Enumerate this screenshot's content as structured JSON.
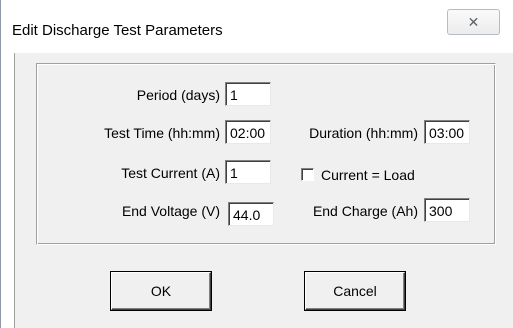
{
  "window": {
    "title": "Edit Discharge Test Parameters",
    "close_glyph": "✕"
  },
  "form": {
    "period_label": "Period (days)",
    "period_value": "1",
    "test_time_label": "Test Time (hh:mm)",
    "test_time_value": "02:00",
    "duration_label": "Duration (hh:mm)",
    "duration_value": "03:00",
    "test_current_label": "Test Current (A)",
    "test_current_value": "1",
    "current_load_label": "Current = Load",
    "current_load_checked": false,
    "end_voltage_label": "End Voltage (V)",
    "end_voltage_value": "44.0",
    "end_charge_label": "End Charge (Ah)",
    "end_charge_value": "300"
  },
  "buttons": {
    "ok_label": "OK",
    "cancel_label": "Cancel"
  }
}
